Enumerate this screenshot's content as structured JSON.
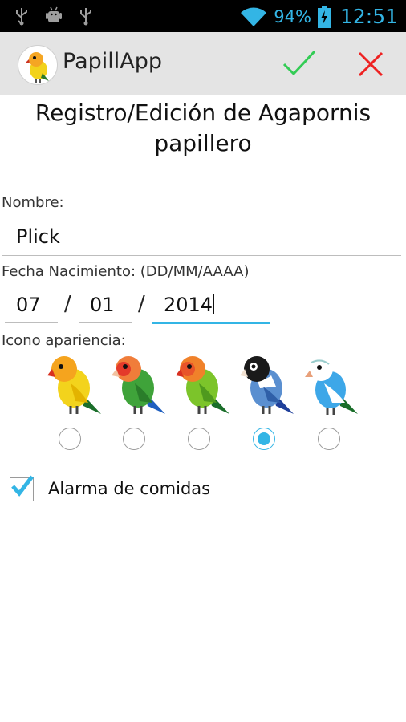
{
  "status_bar": {
    "battery": "94%",
    "time": "12:51",
    "icons": [
      "usb-icon",
      "android-debug-icon",
      "usb-icon",
      "wifi-icon",
      "battery-charging-icon"
    ]
  },
  "action_bar": {
    "title": "PapillApp",
    "accept_icon": "check-icon",
    "cancel_icon": "close-icon",
    "accept_color": "#33cc55",
    "cancel_color": "#ee2222"
  },
  "form": {
    "title": "Registro/Edición de Agapornis papillero",
    "name_label": "Nombre:",
    "name_value": "Plick",
    "date_label": "Fecha Nacimiento: (DD/MM/AAAA)",
    "day": "07",
    "month": "01",
    "year": "2014",
    "separator": "/",
    "icon_label": "Icono apariencia:",
    "icon_options": [
      {
        "icon": "yellow-lovebird-icon",
        "selected": false
      },
      {
        "icon": "peachfaced-lovebird-icon",
        "selected": false
      },
      {
        "icon": "green-lovebird-icon",
        "selected": false
      },
      {
        "icon": "masked-blue-lovebird-icon",
        "selected": true
      },
      {
        "icon": "blue-budgie-icon",
        "selected": false
      }
    ],
    "alarm_label": "Alarma de comidas",
    "alarm_checked": true
  },
  "colors": {
    "accent": "#33b5e5",
    "action_bar_bg": "#e4e4e4",
    "status_bar_bg": "#000000"
  }
}
